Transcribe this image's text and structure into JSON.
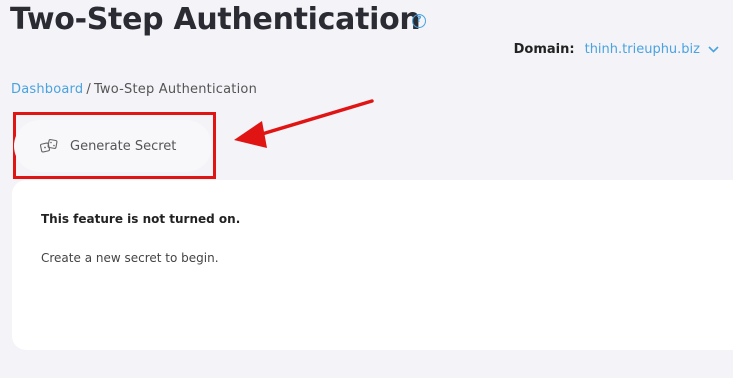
{
  "page": {
    "title": "Two-Step Authentication",
    "help_icon": "question-circle-icon"
  },
  "domain": {
    "label": "Domain:",
    "value": "thinh.trieuphu.biz",
    "icon": "chevron-down-icon"
  },
  "breadcrumb": {
    "items": [
      "Dashboard",
      "Two-Step Authentication"
    ],
    "separator": "/"
  },
  "actions": {
    "generate_label": "Generate Secret",
    "generate_icon": "dice-icon"
  },
  "panel": {
    "status": "This feature is not turned on.",
    "hint": "Create a new secret to begin."
  },
  "annotations": {
    "highlight_color": "#e11414",
    "accent": "#4aa3df"
  }
}
